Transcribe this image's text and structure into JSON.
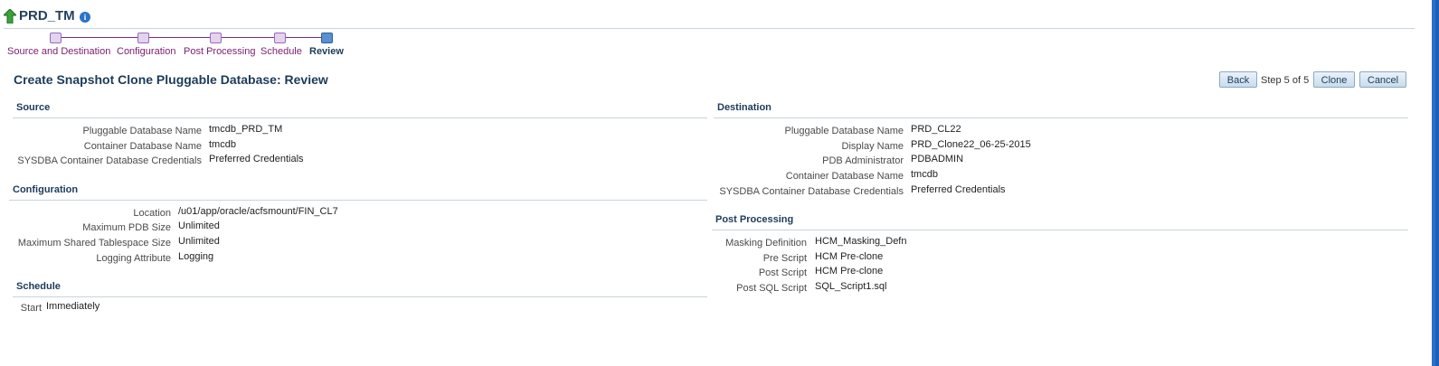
{
  "header": {
    "title": "PRD_TM",
    "up_icon": "green-up-arrow-icon",
    "info_icon": "info-icon",
    "info_glyph": "i"
  },
  "train": {
    "steps": [
      {
        "label": "Source and Destination",
        "state": "visited"
      },
      {
        "label": "Configuration",
        "state": "visited"
      },
      {
        "label": "Post Processing",
        "state": "visited"
      },
      {
        "label": "Schedule",
        "state": "visited"
      },
      {
        "label": "Review",
        "state": "current"
      }
    ]
  },
  "page": {
    "title": "Create Snapshot Clone Pluggable Database: Review"
  },
  "actions": {
    "back": "Back",
    "step_info": "Step 5 of 5",
    "clone": "Clone",
    "cancel": "Cancel"
  },
  "source": {
    "heading": "Source",
    "rows": [
      {
        "label": "Pluggable Database Name",
        "value": "tmcdb_PRD_TM"
      },
      {
        "label": "Container Database Name",
        "value": "tmcdb"
      },
      {
        "label": "SYSDBA Container Database Credentials",
        "value": "Preferred Credentials"
      }
    ]
  },
  "configuration": {
    "heading": "Configuration",
    "rows": [
      {
        "label": "Location",
        "value": "/u01/app/oracle/acfsmount/FIN_CL7"
      },
      {
        "label": "Maximum PDB Size",
        "value": "Unlimited"
      },
      {
        "label": "Maximum Shared Tablespace Size",
        "value": "Unlimited"
      },
      {
        "label": "Logging Attribute",
        "value": "Logging"
      }
    ]
  },
  "schedule": {
    "heading": "Schedule",
    "rows": [
      {
        "label": "Start",
        "value": "Immediately"
      }
    ]
  },
  "destination": {
    "heading": "Destination",
    "rows": [
      {
        "label": "Pluggable Database Name",
        "value": "PRD_CL22"
      },
      {
        "label": "Display Name",
        "value": "PRD_Clone22_06-25-2015"
      },
      {
        "label": "PDB Administrator",
        "value": "PDBADMIN"
      },
      {
        "label": "Container Database Name",
        "value": "tmcdb"
      },
      {
        "label": "SYSDBA Container Database Credentials",
        "value": "Preferred Credentials"
      }
    ]
  },
  "post_processing": {
    "heading": "Post Processing",
    "rows": [
      {
        "label": "Masking Definition",
        "value": "HCM_Masking_Defn"
      },
      {
        "label": "Pre Script",
        "value": "HCM Pre-clone"
      },
      {
        "label": "Post Script",
        "value": "HCM Pre-clone"
      },
      {
        "label": "Post SQL Script",
        "value": "SQL_Script1.sql"
      }
    ]
  }
}
